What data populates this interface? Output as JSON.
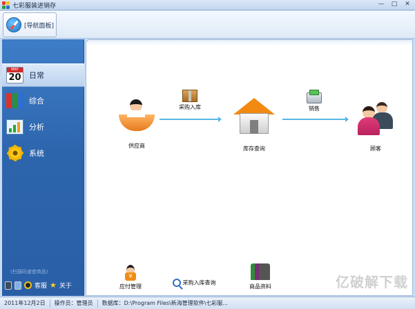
{
  "window": {
    "title": "七彩服装进销存",
    "min_label": "—",
    "max_label": "□",
    "close_label": "✕"
  },
  "toolbar": {
    "nav_panel_label": "[导航面板]"
  },
  "sidebar": {
    "items": [
      {
        "label": "日常",
        "icon": "calendar-icon",
        "calendar_month": "MAY",
        "calendar_day": "20"
      },
      {
        "label": "综合",
        "icon": "binders-icon"
      },
      {
        "label": "分析",
        "icon": "chart-icon"
      },
      {
        "label": "系统",
        "icon": "gear-icon"
      }
    ],
    "hint": "(扫描码速查商品)",
    "support_label": "客服",
    "about_label": "关于"
  },
  "flow": {
    "supplier_label": "供应商",
    "purchase_in_label": "采购入库",
    "inventory_label": "库存查询",
    "sales_label": "销售",
    "customer_label": "顾客"
  },
  "bottom_tools": {
    "payable_label": "应付管理",
    "purchase_query_label": "采购入库查询",
    "product_info_label": "商品资料"
  },
  "watermark": "亿破解下载",
  "status": {
    "date": "2011年12月2日",
    "operator": "操作员：管理员",
    "database": "数据库：D:\\Program Files\\新海管理软件\\七彩服..."
  },
  "colors": {
    "sidebar": "#2d65ad",
    "accent_arrow": "#58b6e8",
    "house_roof": "#f28a12"
  }
}
